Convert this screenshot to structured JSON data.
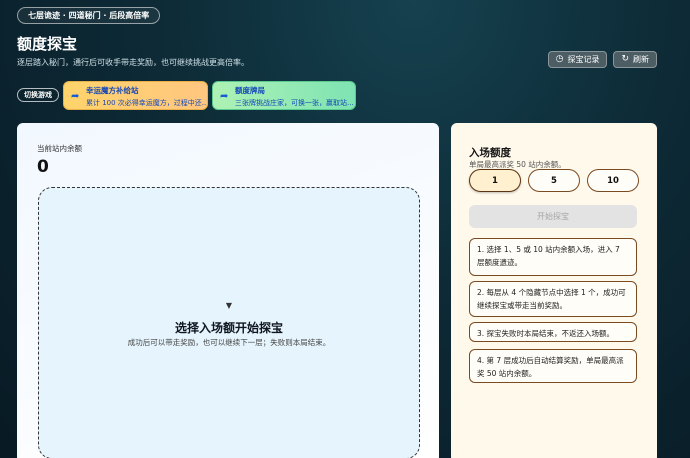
{
  "header": {
    "tag": "七层诡迹 · 四道秘门 · 后段高倍率",
    "title": "额度探宝",
    "subtitle": "逐层踏入秘门，通行后可收手带走奖励，也可继续挑战更高倍率。",
    "actions": [
      {
        "label": "探宝记录",
        "icon": "history-icon"
      },
      {
        "label": "刷新",
        "icon": "refresh-icon"
      }
    ]
  },
  "switcher": {
    "label": "切换游戏",
    "games": [
      {
        "title": "幸运魔方补给站",
        "desc": "累计 100 次必得幸运魔方，过程中还..."
      },
      {
        "title": "额度牌局",
        "desc": "三张牌挑战庄家，可换一张，赢取站..."
      }
    ]
  },
  "main": {
    "balance_label": "当前站内余额",
    "balance_value": "0",
    "drop_title": "选择入场额开始探宝",
    "drop_sub": "成功后可以带走奖励，也可以继续下一层；失败则本局结束。"
  },
  "side": {
    "title": "入场额度",
    "subtitle": "单局最高派奖 50 站内余额。",
    "amounts": [
      "1",
      "5",
      "10"
    ],
    "selected_amount": "1",
    "start_label": "开始探宝",
    "rules": [
      "1. 选择 1、5 或 10 站内余额入场，进入 7 层额度遗迹。",
      "2. 每层从 4 个隐藏节点中选择 1 个，成功可继续探宝或带走当前奖励。",
      "3. 探宝失败时本局结束，不返还入场额。",
      "4. 第 7 层成功后自动结算奖励，单局最高派奖 50 站内余额。"
    ]
  },
  "colors": {
    "accent_blue": "#1548b8",
    "card_yellow": "#ffd46b",
    "card_green": "#7ee3b3",
    "panel_cream": "#fff9ec",
    "border_brown": "#7a4a21"
  }
}
